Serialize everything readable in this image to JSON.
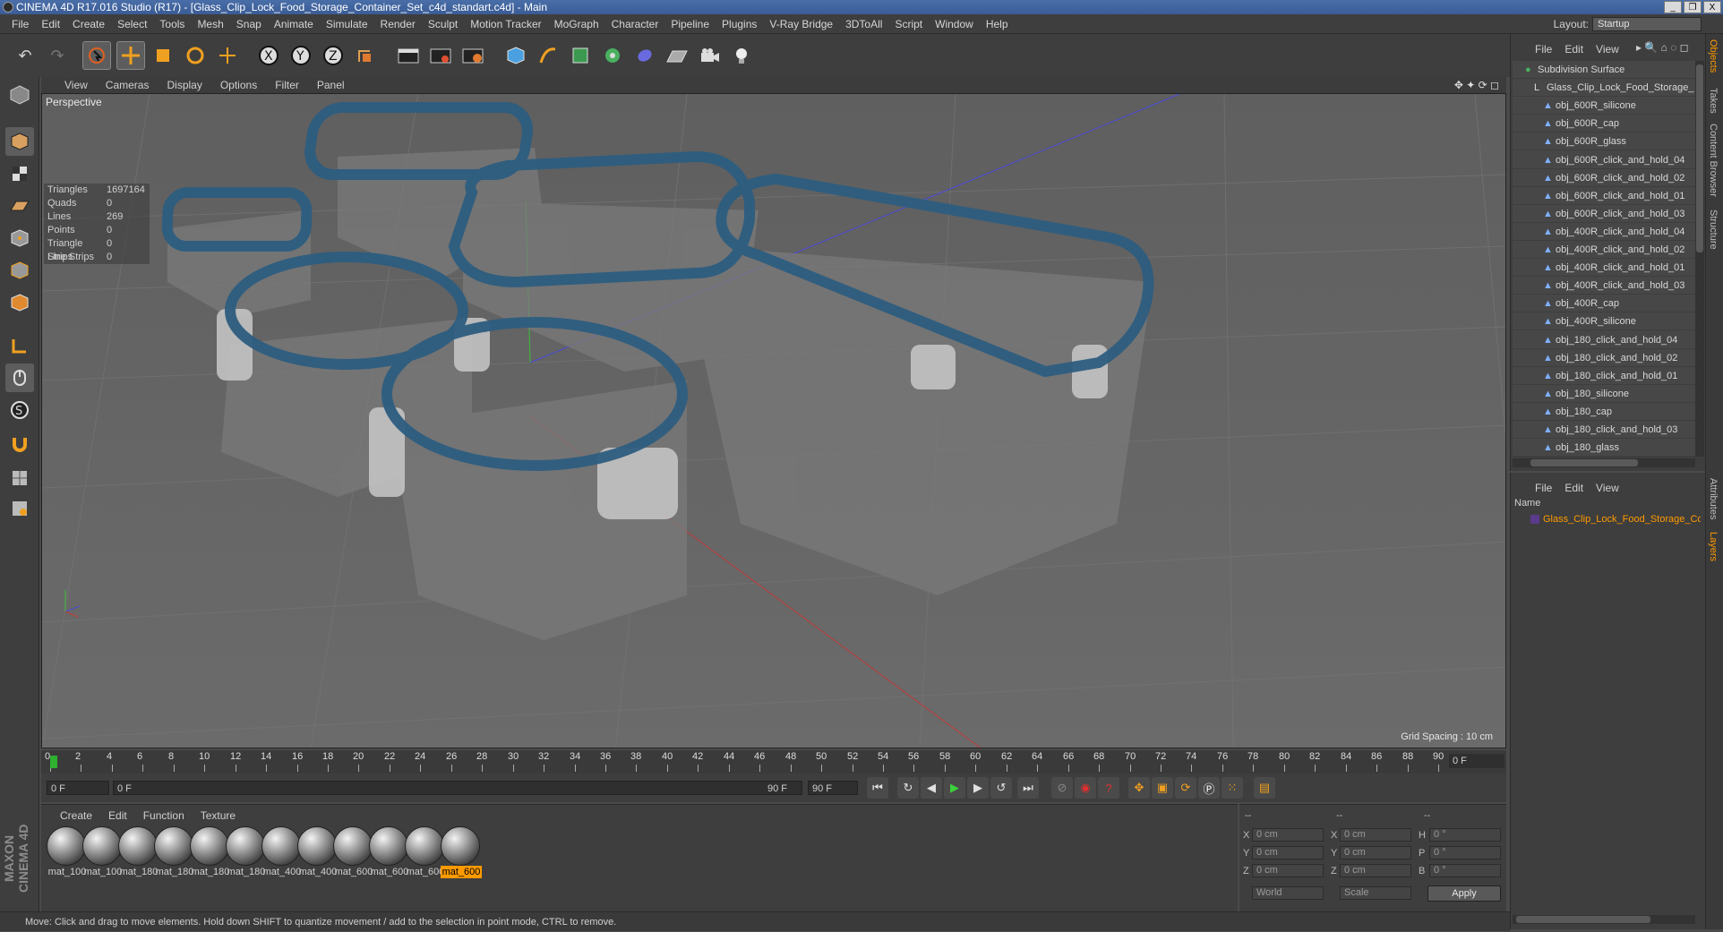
{
  "window": {
    "title": "CINEMA 4D R17.016 Studio (R17) - [Glass_Clip_Lock_Food_Storage_Container_Set_c4d_standart.c4d] - Main",
    "controls": [
      "_",
      "❐",
      "X"
    ]
  },
  "menu": [
    "File",
    "Edit",
    "Create",
    "Select",
    "Tools",
    "Mesh",
    "Snap",
    "Animate",
    "Simulate",
    "Render",
    "Sculpt",
    "Motion Tracker",
    "MoGraph",
    "Character",
    "Pipeline",
    "Plugins",
    "V-Ray Bridge",
    "3DToAll",
    "Script",
    "Window",
    "Help"
  ],
  "layout": {
    "label": "Layout:",
    "value": "Startup"
  },
  "viewport": {
    "menu": [
      "View",
      "Cameras",
      "Display",
      "Options",
      "Filter",
      "Panel"
    ],
    "camera": "Perspective",
    "stats": [
      {
        "k": "Triangles",
        "v": "1697164"
      },
      {
        "k": "Quads",
        "v": "0"
      },
      {
        "k": "Lines",
        "v": "269"
      },
      {
        "k": "Points",
        "v": "0"
      },
      {
        "k": "Triangle Strips",
        "v": "0"
      },
      {
        "k": "Line Strips",
        "v": "0"
      }
    ],
    "grid_spacing": "Grid Spacing : 10 cm"
  },
  "timeline": {
    "ticks": [
      "0",
      "2",
      "4",
      "6",
      "8",
      "10",
      "12",
      "14",
      "16",
      "18",
      "20",
      "22",
      "24",
      "26",
      "28",
      "30",
      "32",
      "34",
      "36",
      "38",
      "40",
      "42",
      "44",
      "46",
      "48",
      "50",
      "52",
      "54",
      "56",
      "58",
      "60",
      "62",
      "64",
      "66",
      "68",
      "70",
      "72",
      "74",
      "76",
      "78",
      "80",
      "82",
      "84",
      "86",
      "88",
      "90"
    ],
    "current_frame": "0 F",
    "start": "0 F",
    "range_start": "0 F",
    "range_end": "90 F",
    "end": "90 F"
  },
  "materials": {
    "menu": [
      "Create",
      "Edit",
      "Function",
      "Texture"
    ],
    "items": [
      "mat_100",
      "mat_100",
      "mat_180",
      "mat_180",
      "mat_180",
      "mat_180",
      "mat_400",
      "mat_400",
      "mat_600",
      "mat_600",
      "mat_600",
      "mat_600"
    ]
  },
  "coords": {
    "headers": [
      "--",
      "--",
      "--"
    ],
    "pos": [
      {
        "l": "X",
        "v": "0 cm"
      },
      {
        "l": "Y",
        "v": "0 cm"
      },
      {
        "l": "Z",
        "v": "0 cm"
      }
    ],
    "size": [
      {
        "l": "X",
        "v": "0 cm"
      },
      {
        "l": "Y",
        "v": "0 cm"
      },
      {
        "l": "Z",
        "v": "0 cm"
      }
    ],
    "rot": [
      {
        "l": "H",
        "v": "0 °"
      },
      {
        "l": "P",
        "v": "0 °"
      },
      {
        "l": "B",
        "v": "0 °"
      }
    ],
    "mode1": "World",
    "mode2": "Scale",
    "apply": "Apply"
  },
  "status": "Move: Click and drag to move elements. Hold down SHIFT to quantize movement / add to the selection in point mode, CTRL to remove.",
  "brand": "MAXON CINEMA 4D",
  "objects": {
    "menu": [
      "File",
      "Edit",
      "View"
    ],
    "items": [
      "Subdivision Surface",
      "Glass_Clip_Lock_Food_Storage_",
      "obj_600R_silicone",
      "obj_600R_cap",
      "obj_600R_glass",
      "obj_600R_click_and_hold_04",
      "obj_600R_click_and_hold_02",
      "obj_600R_click_and_hold_01",
      "obj_600R_click_and_hold_03",
      "obj_400R_click_and_hold_04",
      "obj_400R_click_and_hold_02",
      "obj_400R_click_and_hold_01",
      "obj_400R_click_and_hold_03",
      "obj_400R_cap",
      "obj_400R_silicone",
      "obj_180_click_and_hold_04",
      "obj_180_click_and_hold_02",
      "obj_180_click_and_hold_01",
      "obj_180_silicone",
      "obj_180_cap",
      "obj_180_click_and_hold_03",
      "obj_180_glass"
    ]
  },
  "layers": {
    "menu": [
      "File",
      "Edit",
      "View"
    ],
    "header": "Name",
    "row": "Glass_Clip_Lock_Food_Storage_Con"
  },
  "sidetabs": [
    "Objects",
    "Takes",
    "Content Browser",
    "Structure",
    "Attributes",
    "Layers"
  ]
}
